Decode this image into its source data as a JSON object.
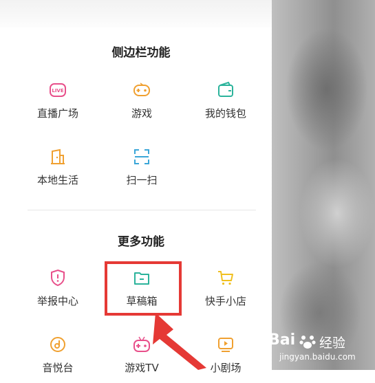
{
  "sidebar_section": {
    "title": "侧边栏功能",
    "items": [
      {
        "label": "直播广场",
        "icon": "live-icon"
      },
      {
        "label": "游戏",
        "icon": "gamepad-icon"
      },
      {
        "label": "我的钱包",
        "icon": "wallet-icon"
      },
      {
        "label": "本地生活",
        "icon": "local-life-icon"
      },
      {
        "label": "扫一扫",
        "icon": "scan-icon"
      }
    ]
  },
  "more_section": {
    "title": "更多功能",
    "items": [
      {
        "label": "举报中心",
        "icon": "report-shield-icon"
      },
      {
        "label": "草稿箱",
        "icon": "drafts-folder-icon"
      },
      {
        "label": "快手小店",
        "icon": "shop-cart-icon"
      },
      {
        "label": "音悦台",
        "icon": "music-icon"
      },
      {
        "label": "游戏TV",
        "icon": "game-tv-icon"
      },
      {
        "label": "小剧场",
        "icon": "mini-theater-icon"
      }
    ]
  },
  "icon_text": {
    "live": "LIVE"
  },
  "watermark": {
    "brand": "Bai",
    "brand2": "经验",
    "url": "jingyan.baidu.com"
  },
  "colors": {
    "pink": "#e84f8a",
    "orange": "#f0a030",
    "green": "#2bb39b",
    "red_highlight": "#e53935"
  }
}
